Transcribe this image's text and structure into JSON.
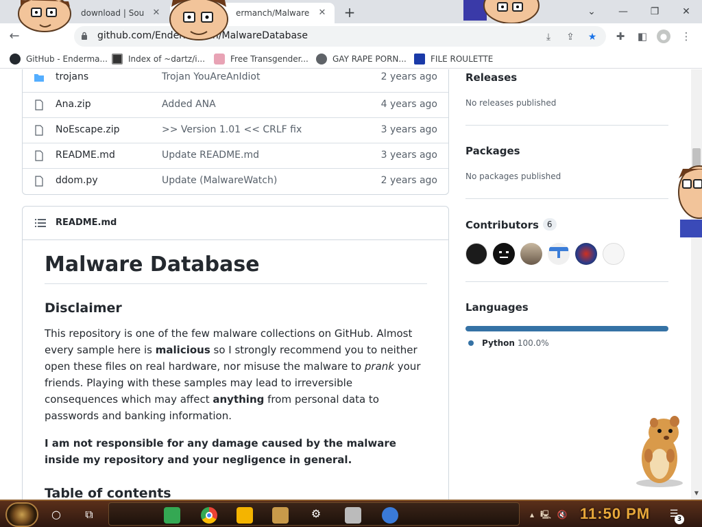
{
  "browser": {
    "tabs": [
      {
        "title": "download | Sou",
        "active": false
      },
      {
        "title": "ermanch/Malware",
        "active": true
      }
    ],
    "new_tab_label": "+",
    "window_controls": {
      "dropdown": "⌄",
      "minimize": "—",
      "restore": "❐",
      "close": "✕"
    },
    "url": "github.com/Enderman.ch/MalwareDatabase",
    "bookmarks": [
      {
        "label": "GitHub - Enderma...",
        "icon": "github-icon",
        "color": "#24292f"
      },
      {
        "label": "Index of ~dartz/i...",
        "icon": "folder-index-icon",
        "color": "#333333"
      },
      {
        "label": "Free Transgender...",
        "icon": "globe-icon",
        "color": "#e8a3b5"
      },
      {
        "label": "GAY RAPE PORN...",
        "icon": "globe-icon",
        "color": "#5f6368"
      },
      {
        "label": "FILE ROULETTE",
        "icon": "file-roulette-icon",
        "color": "#1a3aa8"
      }
    ]
  },
  "files": [
    {
      "name": "trojans",
      "type": "folder",
      "message": "Trojan YouAreAnIdiot",
      "age": "2 years ago"
    },
    {
      "name": "Ana.zip",
      "type": "file",
      "message": "Added ANA",
      "age": "4 years ago"
    },
    {
      "name": "NoEscape.zip",
      "type": "file",
      "message": ">> Version 1.01 << CRLF fix",
      "age": "3 years ago"
    },
    {
      "name": "README.md",
      "type": "file",
      "message": "Update README.md",
      "age": "3 years ago"
    },
    {
      "name": "ddom.py",
      "type": "file",
      "message": "Update (MalwareWatch)",
      "age": "2 years ago"
    }
  ],
  "readme": {
    "filename": "README.md",
    "title": "Malware Database",
    "disclaimer_heading": "Disclaimer",
    "para1_a": "This repository is one of the few malware collections on GitHub. Almost every sample here is ",
    "para1_b": "malicious",
    "para1_c": " so I strongly recommend you to neither open these files on real hardware, nor misuse the malware to ",
    "para1_d": "prank",
    "para1_e": " your friends. Playing with these samples may lead to irreversible consequences which may affect ",
    "para1_f": "anything",
    "para1_g": " from personal data to passwords and banking information.",
    "para2": "I am not responsible for any damage caused by the malware inside my repository and your negligence in general.",
    "toc_heading": "Table of contents"
  },
  "sidebar": {
    "releases_title": "Releases",
    "releases_text": "No releases published",
    "packages_title": "Packages",
    "packages_text": "No packages published",
    "contributors_title": "Contributors",
    "contributors_count": "6",
    "contributor_avatar_colors": [
      "#1b1b1b",
      "#111111",
      "#8a7a6a",
      "#3b7dd8",
      "#2a3a8a",
      "#f0f0f0"
    ],
    "languages_title": "Languages",
    "languages": [
      {
        "name": "Python",
        "percent": "100.0%",
        "color": "#3572a5"
      }
    ]
  },
  "taskbar": {
    "clock": "11:50 PM",
    "notification_count": "3",
    "apps": [
      "search-icon",
      "task-view-icon",
      "green-app-icon",
      "chrome-icon",
      "file-explorer-icon",
      "game-app-icon",
      "settings-icon",
      "mask-app-icon",
      "people-app-icon"
    ]
  }
}
